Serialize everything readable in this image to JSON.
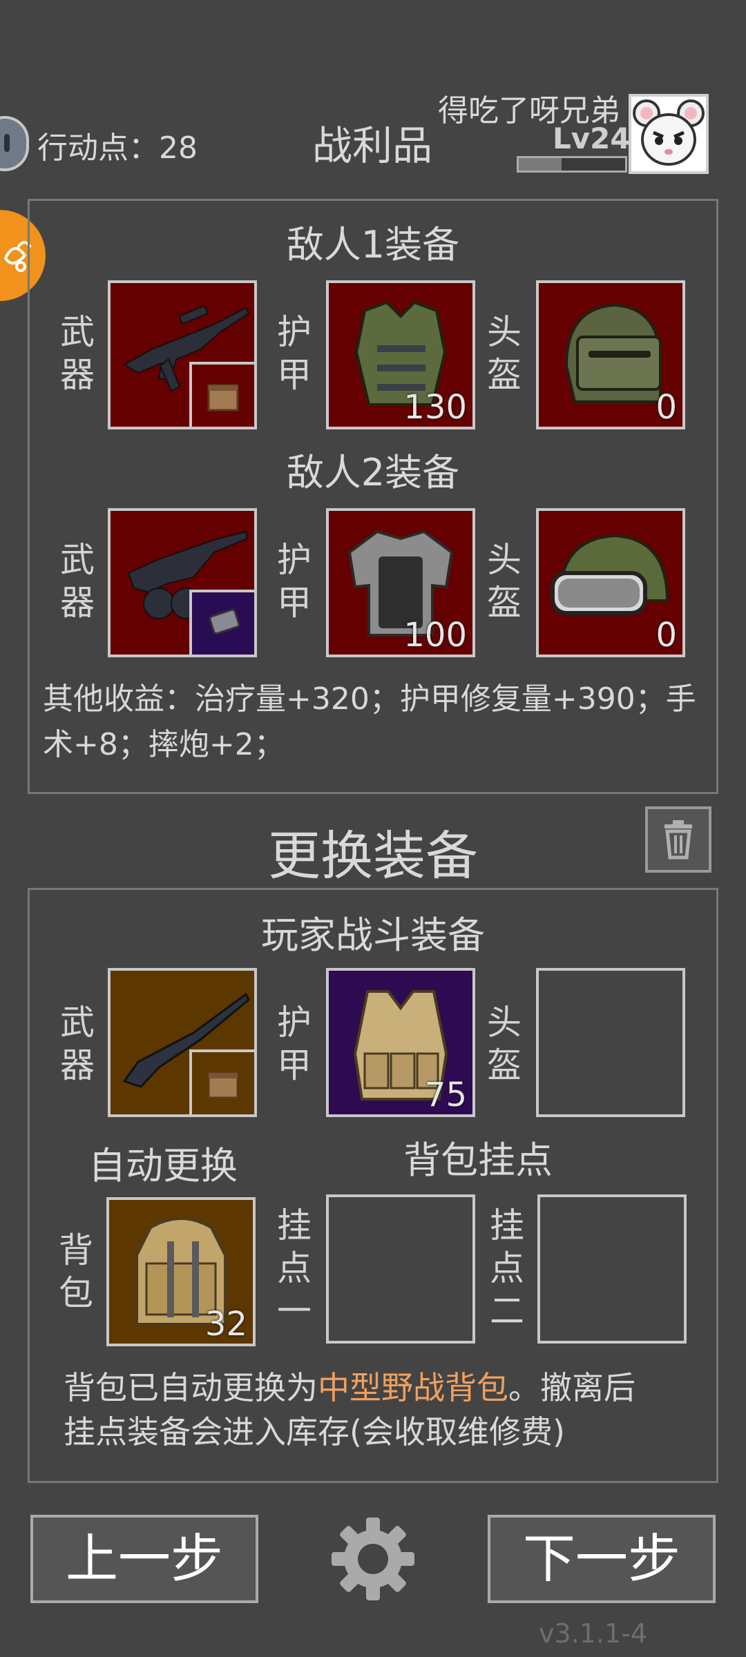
{
  "header": {
    "action_points": "行动点：28",
    "title": "战利品",
    "player_name": "得吃了呀兄弟",
    "level": "Lv24",
    "level_progress": 0.4
  },
  "enemy1": {
    "title": "敌人1装备",
    "weapon_label": [
      "武",
      "器"
    ],
    "armor_label": [
      "护",
      "甲"
    ],
    "helmet_label": [
      "头",
      "盔"
    ],
    "armor_value": "130",
    "helmet_value": "0"
  },
  "enemy2": {
    "title": "敌人2装备",
    "weapon_label": [
      "武",
      "器"
    ],
    "armor_label": [
      "护",
      "甲"
    ],
    "helmet_label": [
      "头",
      "盔"
    ],
    "armor_value": "100",
    "helmet_value": "0"
  },
  "other_income": "其他收益：治疗量+320；护甲修复量+390；手术+8；摔炮+2；",
  "change_title": "更换装备",
  "player": {
    "title": "玩家战斗装备",
    "weapon_label": [
      "武",
      "器"
    ],
    "armor_label": [
      "护",
      "甲"
    ],
    "helmet_label": [
      "头",
      "盔"
    ],
    "armor_value": "75",
    "auto_replace": "自动更换",
    "backpack_mounts": "背包挂点",
    "backpack_label": [
      "背",
      "包"
    ],
    "backpack_value": "32",
    "mount1_label": [
      "挂",
      "点",
      "一"
    ],
    "mount2_label": [
      "挂",
      "点",
      "二"
    ]
  },
  "notice": {
    "line1_prefix": "背包已自动更换为",
    "line1_highlight": "中型野战背包",
    "line1_suffix": "。撤离后",
    "line2": "挂点装备会进入库存(会收取维修费)"
  },
  "buttons": {
    "prev": "上一步",
    "next": "下一步"
  },
  "version": "v3.1.1-4",
  "colors": {
    "background": "#444444",
    "highlight": "#f0a060",
    "orange_badge": "#f0921c"
  }
}
